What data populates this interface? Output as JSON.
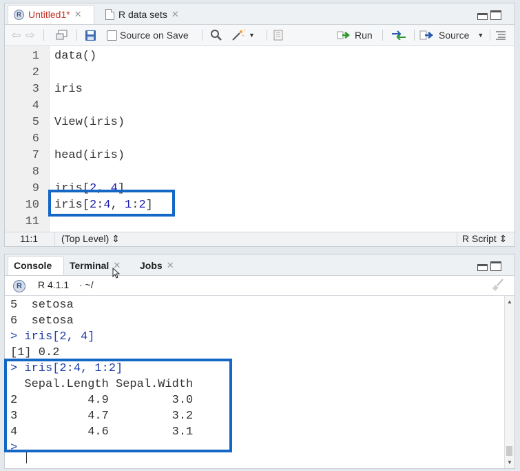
{
  "editor": {
    "tabs": [
      {
        "label": "Untitled1*",
        "icon": "r-script-icon",
        "active": true
      },
      {
        "label": "R data sets",
        "icon": "document-icon",
        "active": false
      }
    ],
    "toolbar": {
      "source_on_save": "Source on Save",
      "run": "Run",
      "source": "Source"
    },
    "lines": [
      {
        "n": "1",
        "code": "data()"
      },
      {
        "n": "2",
        "code": ""
      },
      {
        "n": "3",
        "code": "iris"
      },
      {
        "n": "4",
        "code": ""
      },
      {
        "n": "5",
        "code": "View(iris)"
      },
      {
        "n": "6",
        "code": ""
      },
      {
        "n": "7",
        "code": "head(iris)"
      },
      {
        "n": "8",
        "code": ""
      },
      {
        "n": "9",
        "code": "iris[2, 4]"
      },
      {
        "n": "10",
        "code": "iris[2:4, 1:2]"
      },
      {
        "n": "11",
        "code": ""
      }
    ],
    "status": {
      "position": "11:1",
      "scope": "(Top Level) ⇕",
      "filetype": "R Script ⇕"
    }
  },
  "console": {
    "tabs": [
      "Console",
      "Terminal",
      "Jobs"
    ],
    "version": "R 4.1.1",
    "path": "· ~/",
    "lines": [
      {
        "text": "5  setosa",
        "cmd": false
      },
      {
        "text": "6  setosa",
        "cmd": false
      },
      {
        "text": "> iris[2, 4]",
        "cmd": true
      },
      {
        "text": "[1] 0.2",
        "cmd": false
      },
      {
        "text": "> iris[2:4, 1:2]",
        "cmd": true
      },
      {
        "text": "  Sepal.Length Sepal.Width",
        "cmd": false
      },
      {
        "text": "2          4.9         3.0",
        "cmd": false
      },
      {
        "text": "3          4.7         3.2",
        "cmd": false
      },
      {
        "text": "4          4.6         3.1",
        "cmd": false
      },
      {
        "text": ">",
        "cmd": true
      }
    ]
  },
  "colors": {
    "highlight": "#1567c5",
    "command": "#1f3fa8",
    "number": "#1e1eb0",
    "run_green": "#2e9a2e"
  }
}
